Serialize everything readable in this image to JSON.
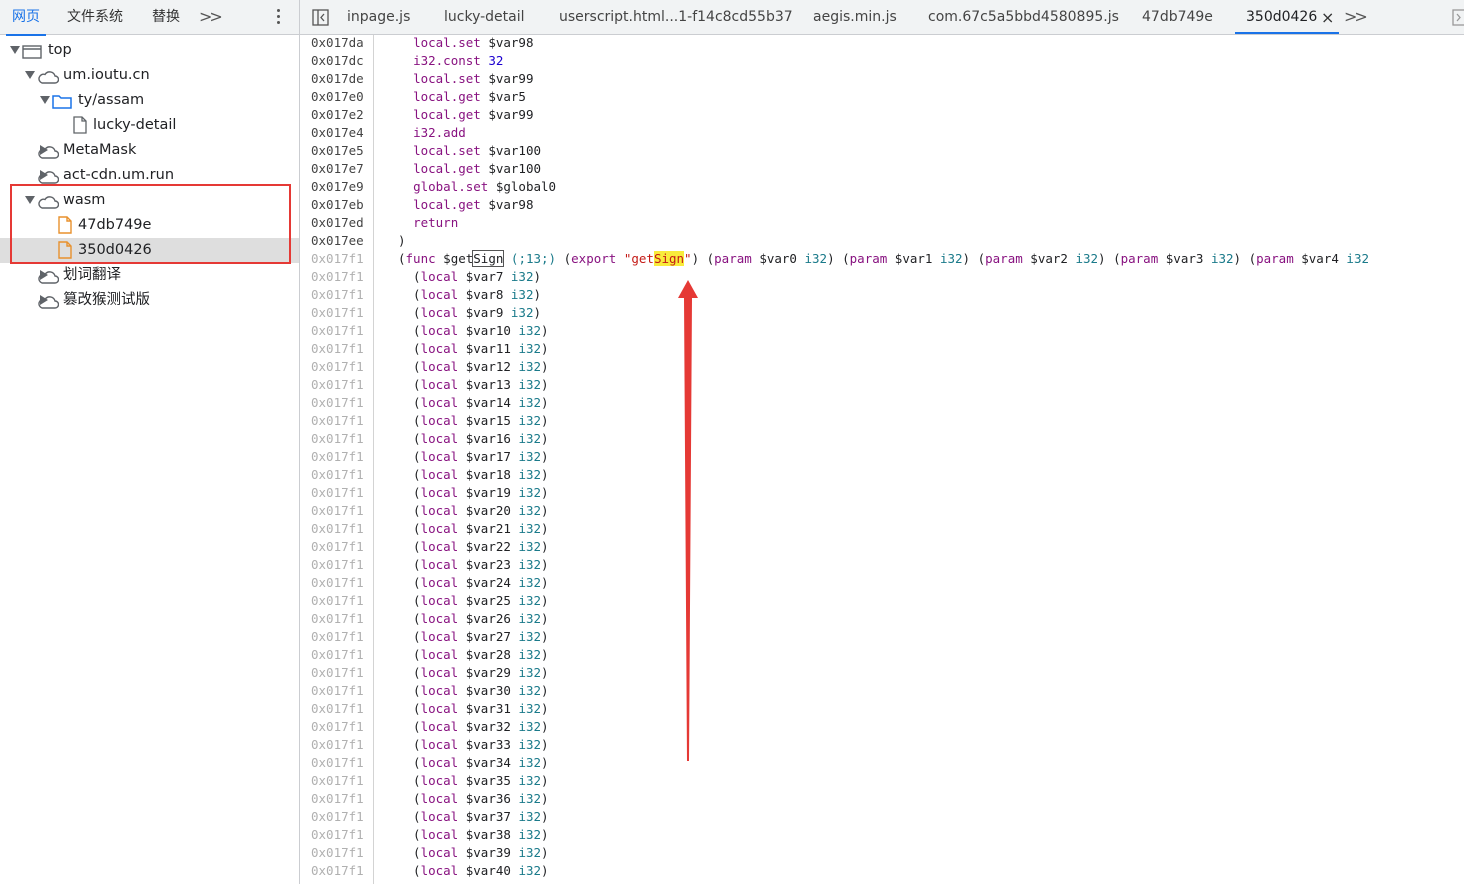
{
  "navigator": {
    "tabs": [
      "网页",
      "文件系统",
      "替换"
    ],
    "active_tab": "网页",
    "tree": [
      {
        "label": "top",
        "depth": 0,
        "expanded": true,
        "icon": "frame-icon"
      },
      {
        "label": "um.ioutu.cn",
        "depth": 1,
        "expanded": true,
        "icon": "cloud-icon"
      },
      {
        "label": "ty/assam",
        "depth": 2,
        "expanded": true,
        "icon": "folder-icon"
      },
      {
        "label": "lucky-detail",
        "depth": 3,
        "icon": "file-icon"
      },
      {
        "label": "MetaMask",
        "depth": 1,
        "expanded": false,
        "icon": "cloud-icon"
      },
      {
        "label": "act-cdn.um.run",
        "depth": 1,
        "expanded": false,
        "icon": "cloud-icon"
      },
      {
        "label": "wasm",
        "depth": 1,
        "expanded": true,
        "icon": "cloud-icon"
      },
      {
        "label": "47db749e",
        "depth": 2,
        "icon": "wasm-file-icon"
      },
      {
        "label": "350d0426",
        "depth": 2,
        "icon": "wasm-file-icon",
        "selected": true
      },
      {
        "label": "划词翻译",
        "depth": 1,
        "expanded": false,
        "icon": "cloud-icon"
      },
      {
        "label": "篡改猴测试版",
        "depth": 1,
        "expanded": false,
        "icon": "cloud-icon"
      }
    ]
  },
  "editor": {
    "tabs": [
      "inpage.js",
      "lucky-detail",
      "userscript.html...1-f14c8cd55b37",
      "aegis.min.js",
      "com.67c5a5bbd4580895.js",
      "47db749e",
      "350d0426"
    ],
    "active_tab": "350d0426",
    "close_glyph": "×",
    "lines": [
      {
        "addr": "0x017da",
        "dim": false,
        "text": "  local.set $var98"
      },
      {
        "addr": "0x017dc",
        "dim": false,
        "text": "  i32.const 32"
      },
      {
        "addr": "0x017de",
        "dim": false,
        "text": "  local.set $var99"
      },
      {
        "addr": "0x017e0",
        "dim": false,
        "text": "  local.get $var5"
      },
      {
        "addr": "0x017e2",
        "dim": false,
        "text": "  local.get $var99"
      },
      {
        "addr": "0x017e4",
        "dim": false,
        "text": "  i32.add"
      },
      {
        "addr": "0x017e5",
        "dim": false,
        "text": "  local.set $var100"
      },
      {
        "addr": "0x017e7",
        "dim": false,
        "text": "  local.get $var100"
      },
      {
        "addr": "0x017e9",
        "dim": false,
        "text": "  global.set $global0"
      },
      {
        "addr": "0x017eb",
        "dim": false,
        "text": "  local.get $var98"
      },
      {
        "addr": "0x017ed",
        "dim": false,
        "text": "  return"
      },
      {
        "addr": "0x017ee",
        "dim": false,
        "text": ")"
      },
      {
        "addr": "0x017f1",
        "dim": true,
        "text": "(func $getSign (;13;) (export \"getSign\") (param $var0 i32) (param $var1 i32) (param $var2 i32) (param $var3 i32) (param $var4 i32"
      },
      {
        "addr": "0x017f1",
        "dim": true,
        "text": "  (local $var7 i32)"
      },
      {
        "addr": "0x017f1",
        "dim": true,
        "text": "  (local $var8 i32)"
      },
      {
        "addr": "0x017f1",
        "dim": true,
        "text": "  (local $var9 i32)"
      },
      {
        "addr": "0x017f1",
        "dim": true,
        "text": "  (local $var10 i32)"
      },
      {
        "addr": "0x017f1",
        "dim": true,
        "text": "  (local $var11 i32)"
      },
      {
        "addr": "0x017f1",
        "dim": true,
        "text": "  (local $var12 i32)"
      },
      {
        "addr": "0x017f1",
        "dim": true,
        "text": "  (local $var13 i32)"
      },
      {
        "addr": "0x017f1",
        "dim": true,
        "text": "  (local $var14 i32)"
      },
      {
        "addr": "0x017f1",
        "dim": true,
        "text": "  (local $var15 i32)"
      },
      {
        "addr": "0x017f1",
        "dim": true,
        "text": "  (local $var16 i32)"
      },
      {
        "addr": "0x017f1",
        "dim": true,
        "text": "  (local $var17 i32)"
      },
      {
        "addr": "0x017f1",
        "dim": true,
        "text": "  (local $var18 i32)"
      },
      {
        "addr": "0x017f1",
        "dim": true,
        "text": "  (local $var19 i32)"
      },
      {
        "addr": "0x017f1",
        "dim": true,
        "text": "  (local $var20 i32)"
      },
      {
        "addr": "0x017f1",
        "dim": true,
        "text": "  (local $var21 i32)"
      },
      {
        "addr": "0x017f1",
        "dim": true,
        "text": "  (local $var22 i32)"
      },
      {
        "addr": "0x017f1",
        "dim": true,
        "text": "  (local $var23 i32)"
      },
      {
        "addr": "0x017f1",
        "dim": true,
        "text": "  (local $var24 i32)"
      },
      {
        "addr": "0x017f1",
        "dim": true,
        "text": "  (local $var25 i32)"
      },
      {
        "addr": "0x017f1",
        "dim": true,
        "text": "  (local $var26 i32)"
      },
      {
        "addr": "0x017f1",
        "dim": true,
        "text": "  (local $var27 i32)"
      },
      {
        "addr": "0x017f1",
        "dim": true,
        "text": "  (local $var28 i32)"
      },
      {
        "addr": "0x017f1",
        "dim": true,
        "text": "  (local $var29 i32)"
      },
      {
        "addr": "0x017f1",
        "dim": true,
        "text": "  (local $var30 i32)"
      },
      {
        "addr": "0x017f1",
        "dim": true,
        "text": "  (local $var31 i32)"
      },
      {
        "addr": "0x017f1",
        "dim": true,
        "text": "  (local $var32 i32)"
      },
      {
        "addr": "0x017f1",
        "dim": true,
        "text": "  (local $var33 i32)"
      },
      {
        "addr": "0x017f1",
        "dim": true,
        "text": "  (local $var34 i32)"
      },
      {
        "addr": "0x017f1",
        "dim": true,
        "text": "  (local $var35 i32)"
      },
      {
        "addr": "0x017f1",
        "dim": true,
        "text": "  (local $var36 i32)"
      },
      {
        "addr": "0x017f1",
        "dim": true,
        "text": "  (local $var37 i32)"
      },
      {
        "addr": "0x017f1",
        "dim": true,
        "text": "  (local $var38 i32)"
      },
      {
        "addr": "0x017f1",
        "dim": true,
        "text": "  (local $var39 i32)"
      },
      {
        "addr": "0x017f1",
        "dim": true,
        "text": "  (local $var40 i32)"
      }
    ],
    "search_highlight": "Sign"
  },
  "colors": {
    "accent": "#1a73e8",
    "annotation_red": "#e53935",
    "keyword": "#881280",
    "type": "#1a7a8a",
    "number": "#1c00cf",
    "string": "#c41a16",
    "highlight": "#f9ec3b"
  }
}
